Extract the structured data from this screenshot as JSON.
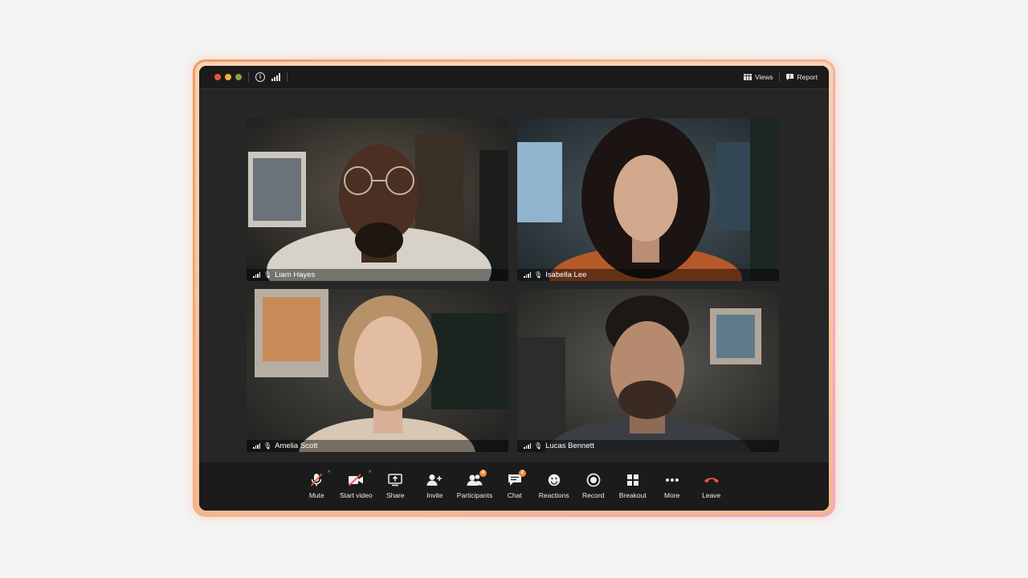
{
  "window": {
    "traffic_lights": [
      "#e5543f",
      "#f2b13a",
      "#7fa64a"
    ],
    "views_label": "Views",
    "report_label": "Report"
  },
  "participants": [
    {
      "name": "Liam Hayes"
    },
    {
      "name": "Isabella Lee"
    },
    {
      "name": "Amelia Scott"
    },
    {
      "name": "Lucas Bennett"
    }
  ],
  "toolbar": {
    "mute_label": "Mute",
    "start_video_label": "Start video",
    "share_label": "Share",
    "invite_label": "Invite",
    "participants_label": "Participants",
    "participants_count": "4",
    "chat_label": "Chat",
    "chat_count": "2",
    "reactions_label": "Reactions",
    "record_label": "Record",
    "breakout_label": "Breakout",
    "more_label": "More",
    "leave_label": "Leave"
  },
  "colors": {
    "accent": "#f28a3c",
    "leave": "#e8553d",
    "muted_slash": "#e8553d"
  }
}
